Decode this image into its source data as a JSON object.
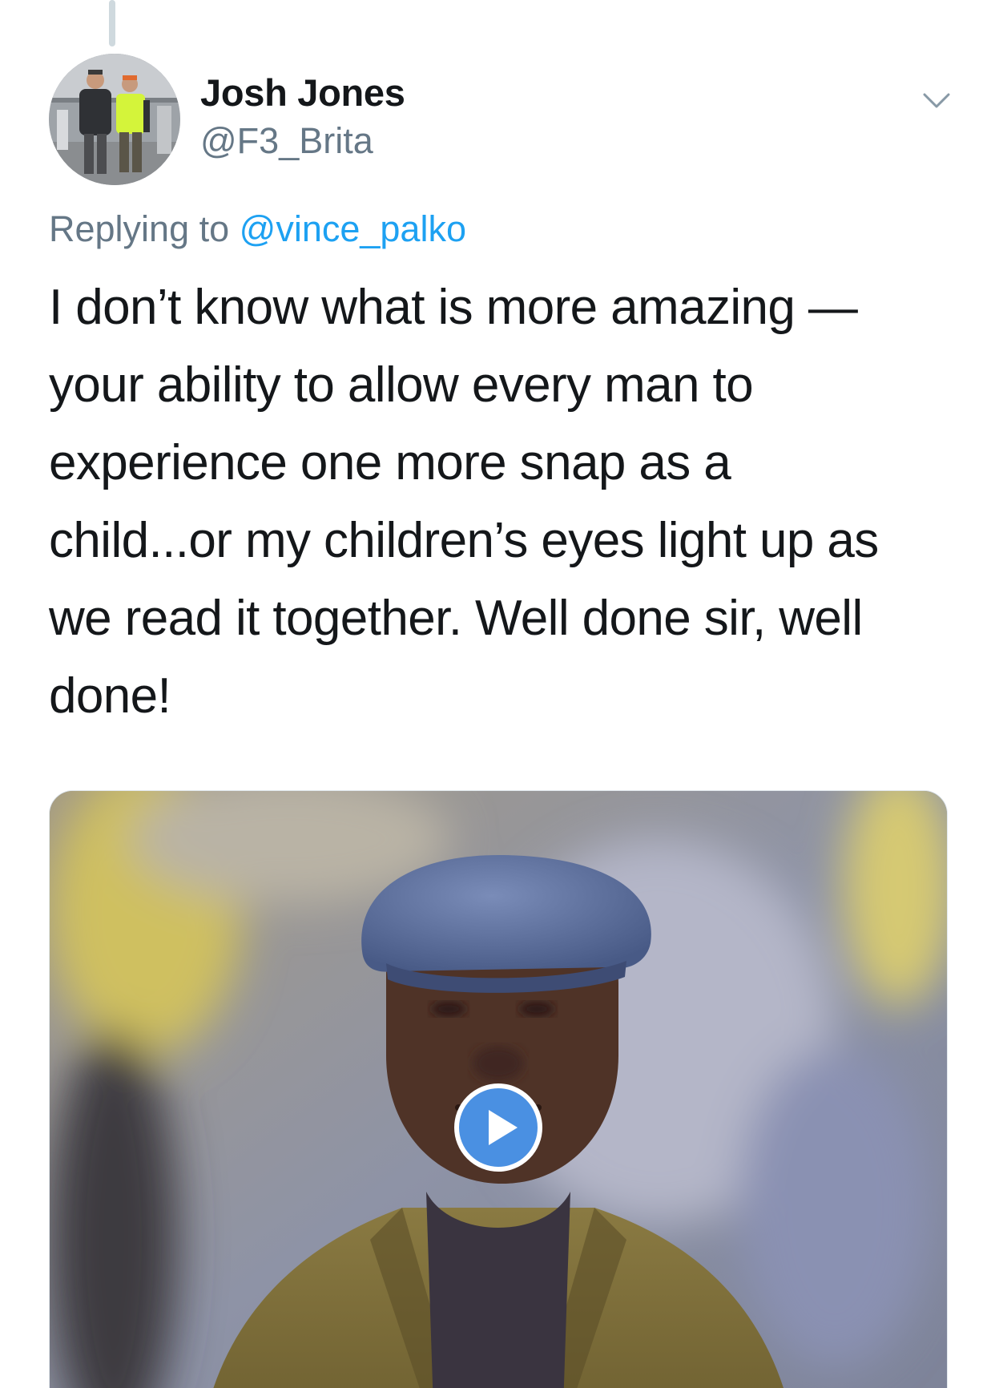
{
  "tweet": {
    "author": {
      "display_name": "Josh Jones",
      "handle": "@F3_Brita"
    },
    "reply_context": {
      "prefix": "Replying to ",
      "mention": "@vince_palko"
    },
    "text_lines": [
      "I don’t know what is more amazing —",
      "your ability to allow every man to",
      "experience one more snap as a",
      "child...or my children’s eyes light up as",
      "we read it together. Well done sir, well",
      "done!"
    ],
    "media": {
      "type": "video",
      "play_icon": "play-icon"
    },
    "menu_icon": "chevron-down-icon"
  },
  "colors": {
    "name_text": "#14171a",
    "secondary_text": "#657786",
    "link": "#1da1f2",
    "play_button": "#4a90e2",
    "thread_line": "#cfd9de"
  }
}
